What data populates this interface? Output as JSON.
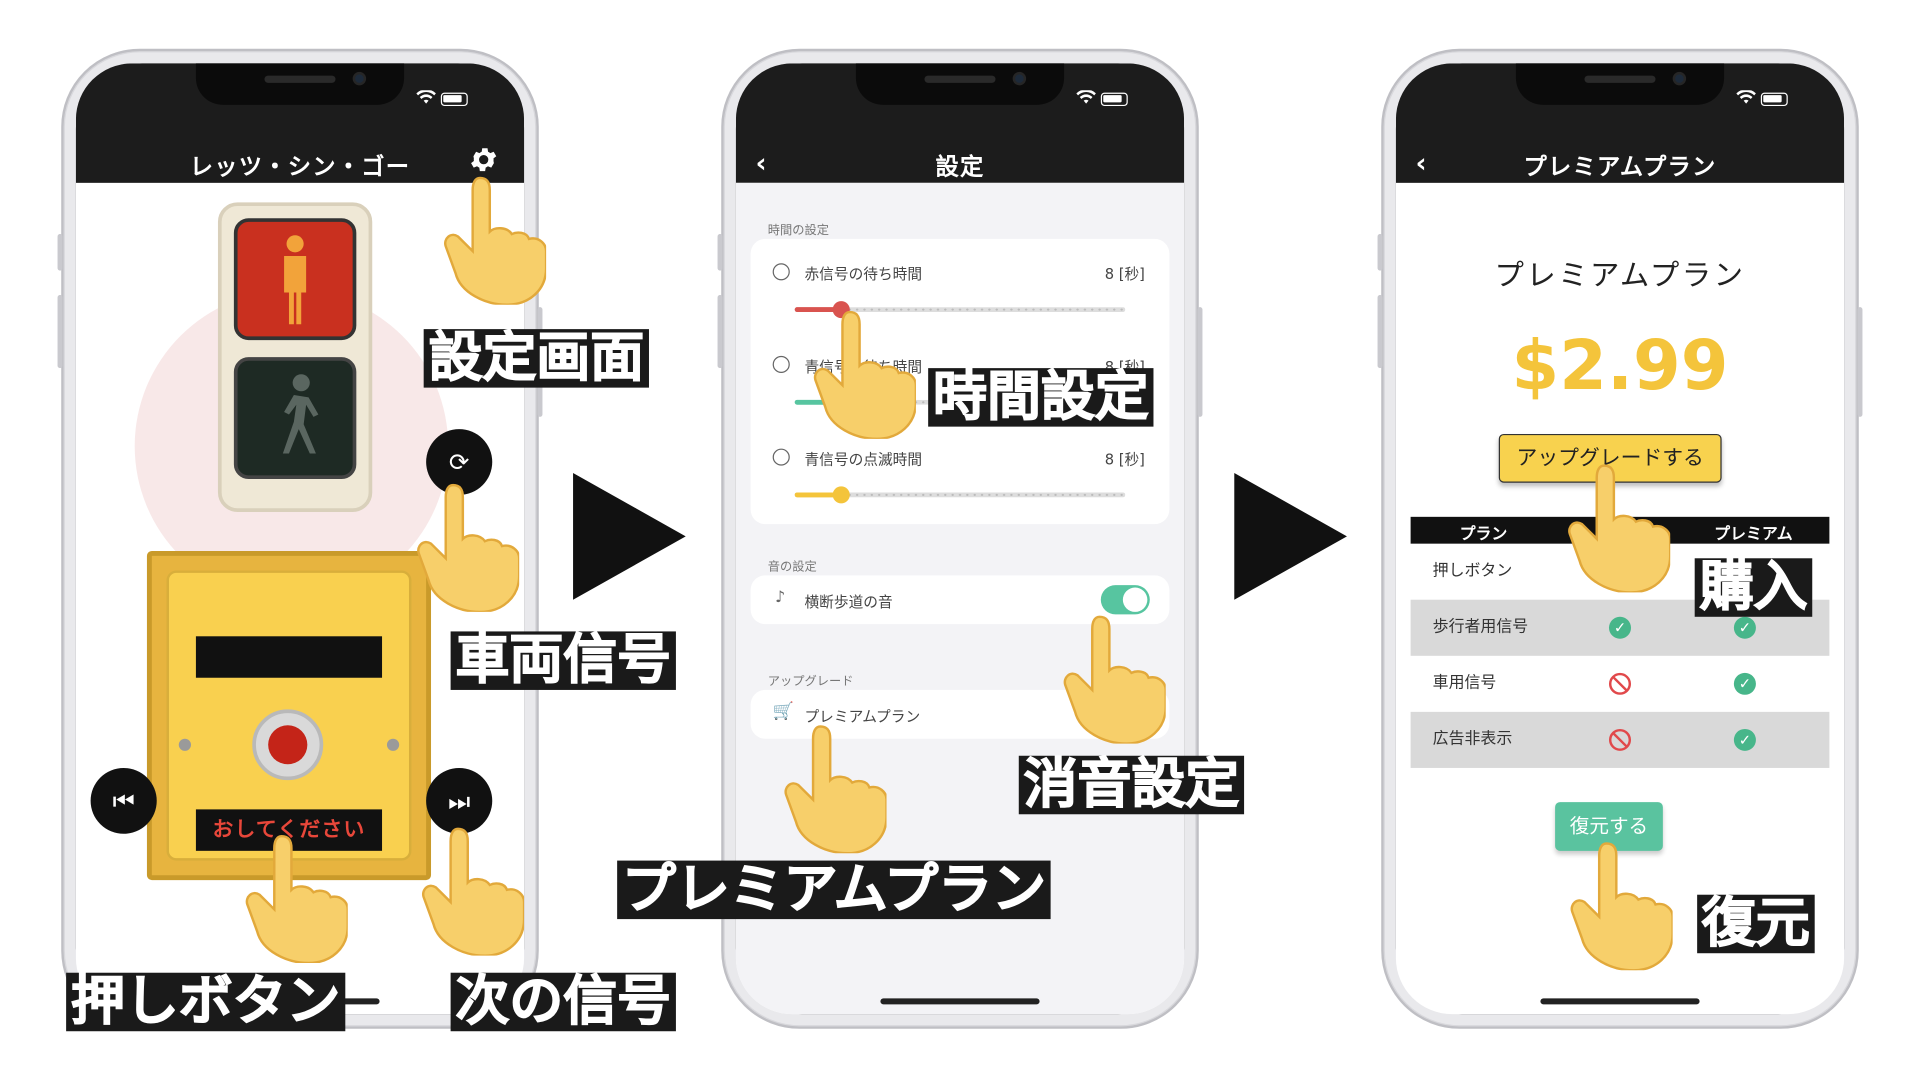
{
  "phone1": {
    "title": "レッツ・シン・ゴー",
    "push_label": "おしてください",
    "icons": {
      "settings": "gear-icon",
      "refresh": "refresh-icon",
      "prev": "skip-previous-icon",
      "next": "skip-next-icon"
    }
  },
  "phone2": {
    "title": "設定",
    "section_time": "時間の設定",
    "rows": [
      {
        "label": "赤信号の待ち時間",
        "value": "8 [秒]",
        "color": "#d9534f"
      },
      {
        "label": "青信号の待ち時間",
        "value": "8 [秒]",
        "color": "#57c5a0"
      },
      {
        "label": "青信号の点滅時間",
        "value": "8 [秒]",
        "color": "#f4c43b"
      }
    ],
    "section_sound": "音の設定",
    "sound_label": "横断歩道の音",
    "sound_on": true,
    "section_upgrade": "アップグレード",
    "upgrade_label": "プレミアムプラン"
  },
  "phone3": {
    "title": "プレミアムプラン",
    "heading": "プレミアムプラン",
    "price": "$2.99",
    "upgrade_button": "アップグレードする",
    "table_headers": [
      "プラン",
      "プレミアム"
    ],
    "table_rows": [
      {
        "label": "押しボタン",
        "free": "ok",
        "premium": "ok"
      },
      {
        "label": "歩行者用信号",
        "free": "ok",
        "premium": "ok"
      },
      {
        "label": "車用信号",
        "free": "no",
        "premium": "ok"
      },
      {
        "label": "広告非表示",
        "free": "no",
        "premium": "ok"
      }
    ],
    "restore_button": "復元する"
  },
  "callouts": {
    "settings_screen": "設定画面",
    "vehicle_signal": "車両信号",
    "push_button": "押しボタン",
    "next_signal": "次の信号",
    "time_setting": "時間設定",
    "mute_setting": "消音設定",
    "premium_plan": "プレミアムプラン",
    "purchase": "購入",
    "restore": "復元"
  },
  "colors": {
    "accent_green": "#57c5a0",
    "accent_yellow": "#f4c43b",
    "signal_red": "#c9301f",
    "error_red": "#e1494b",
    "bar": "#1c1c1c"
  }
}
